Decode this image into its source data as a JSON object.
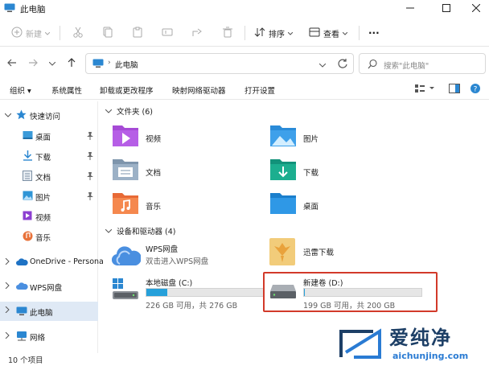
{
  "window": {
    "title": "此电脑"
  },
  "toolbar": {
    "new_label": "新建",
    "sort_label": "排序",
    "view_label": "查看",
    "more_label": "···"
  },
  "address": {
    "path": "此电脑",
    "search_placeholder": "搜索\"此电脑\""
  },
  "ribbon": {
    "items": [
      "组织",
      "系统属性",
      "卸载或更改程序",
      "映射网络驱动器",
      "打开设置"
    ]
  },
  "sidebar": {
    "quick_access": "快速访问",
    "items": [
      {
        "label": "桌面",
        "icon": "desktop-icon"
      },
      {
        "label": "下载",
        "icon": "download-icon"
      },
      {
        "label": "文档",
        "icon": "document-icon"
      },
      {
        "label": "图片",
        "icon": "picture-icon"
      },
      {
        "label": "视频",
        "icon": "video-icon"
      },
      {
        "label": "音乐",
        "icon": "music-icon"
      }
    ],
    "onedrive": "OneDrive - Persona",
    "wps": "WPS网盘",
    "this_pc": "此电脑",
    "network": "网络"
  },
  "folders": {
    "header": "文件夹 (6)",
    "items": [
      "视频",
      "图片",
      "文档",
      "下载",
      "音乐",
      "桌面"
    ]
  },
  "devices": {
    "header": "设备和驱动器 (4)",
    "wps": {
      "name": "WPS网盘",
      "sub": "双击进入WPS网盘"
    },
    "xunlei": {
      "name": "迅雷下载"
    },
    "c": {
      "name": "本地磁盘 (C:)",
      "sub": "226 GB 可用，共 276 GB",
      "used_fraction": 0.18
    },
    "d": {
      "name": "新建卷 (D:)",
      "sub": "199 GB 可用，共 200 GB",
      "used_fraction": 0.005
    }
  },
  "status": {
    "count": "10 个项目"
  },
  "watermark": {
    "text": "爱纯净",
    "url": "aichunjing.com"
  },
  "colors": {
    "accent": "#26a0da",
    "highlight": "#d23a2a",
    "selected": "#dfe9f5"
  }
}
